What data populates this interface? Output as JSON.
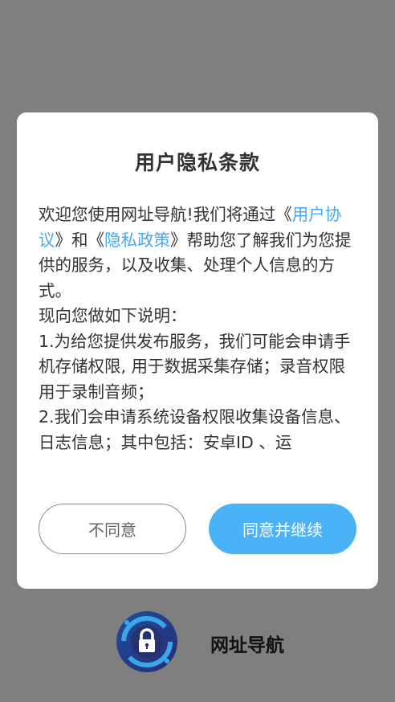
{
  "dialog": {
    "title": "用户隐私条款",
    "body": {
      "p1_a": "欢迎您使用网址导航!我们将通过《",
      "p1_link1": "用户协议",
      "p1_b": "》和《",
      "p1_link2": "隐私政策",
      "p1_c": "》帮助您了解我们为您提供的服务，以及收集、处理个人信息的方式。",
      "p2": "现向您做如下说明：",
      "p3": "1.为给您提供发布服务，我们可能会申请手机存储权限, 用于数据采集存储；录音权限用于录制音频；",
      "p4": "2.我们会申请系统设备权限收集设备信息、日志信息；其中包括：安卓ID 、运"
    },
    "buttons": {
      "disagree": "不同意",
      "agree": "同意并继续"
    }
  },
  "brand": {
    "name": "网址导航",
    "logo_icon": "lock-shield-icon"
  },
  "colors": {
    "overlay": "#7f7f7f",
    "accent": "#4ab3f7",
    "link": "#4aa8ef"
  }
}
